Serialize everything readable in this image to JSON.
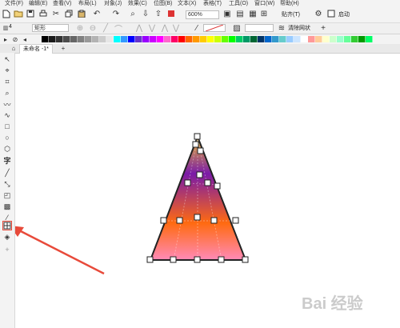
{
  "menu": {
    "items": [
      {
        "label": "文件(F)"
      },
      {
        "label": "编辑(E)"
      },
      {
        "label": "查看(V)"
      },
      {
        "label": "布局(L)"
      },
      {
        "label": "对象(J)"
      },
      {
        "label": "效果(C)"
      },
      {
        "label": "位图(B)"
      },
      {
        "label": "文本(X)"
      },
      {
        "label": "表格(T)"
      },
      {
        "label": "工具(O)"
      },
      {
        "label": "窗口(W)"
      },
      {
        "label": "帮助(H)"
      }
    ]
  },
  "toolbar": {
    "zoom_value": "600%",
    "snap_label": "贴齐(T)",
    "launch_label": "启动"
  },
  "propertybar": {
    "shape_value": "矩形",
    "clear_mesh_label": "清除网状"
  },
  "tab": {
    "document_name": "未命名 -1*",
    "add_tab": "+"
  },
  "palette": {
    "colors": [
      "#000000",
      "#1a1a1a",
      "#333333",
      "#4d4d4d",
      "#666666",
      "#808080",
      "#999999",
      "#b3b3b3",
      "#cccccc",
      "#e6e6e6",
      "#00ffff",
      "#3399ff",
      "#0000ff",
      "#6633cc",
      "#9900ff",
      "#cc00ff",
      "#ff00ff",
      "#ff66cc",
      "#ff0066",
      "#ff0000",
      "#ff6600",
      "#ff9900",
      "#ffcc00",
      "#ffff00",
      "#ccff00",
      "#66ff00",
      "#00ff00",
      "#00cc66",
      "#009966",
      "#006633",
      "#003366",
      "#0066cc",
      "#3399cc",
      "#66cccc",
      "#99ccff",
      "#cce5ff",
      "#ffffff",
      "#ff9999",
      "#ffcc99",
      "#ffffcc",
      "#ccffcc",
      "#99ffcc",
      "#66ff99",
      "#33cc33",
      "#009900",
      "#00ff66"
    ]
  },
  "artwork": {
    "shape": "mesh-filled-triangle",
    "colors": {
      "top": "#e8b830",
      "upper": "#7a1aa8",
      "middle": "#ff6a10",
      "bottom": "#ff8ab8",
      "outline": "#222222",
      "arrow": "#e84a3a"
    }
  },
  "watermark": "Bai 经验"
}
